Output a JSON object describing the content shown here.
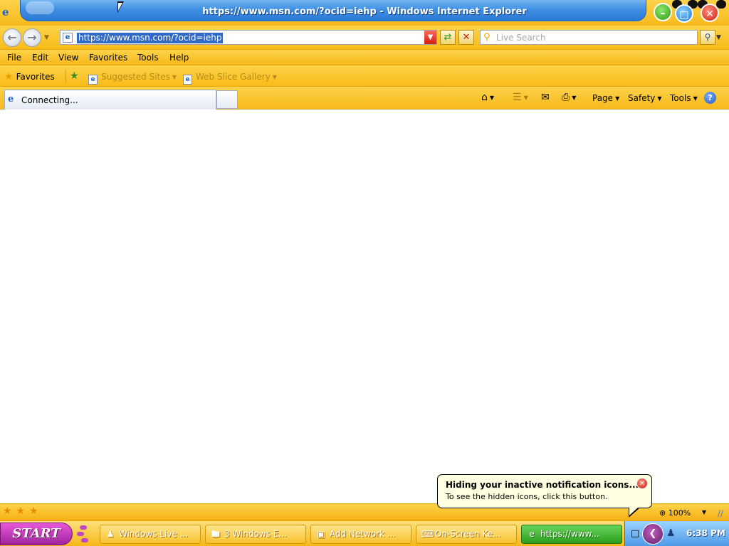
{
  "window": {
    "title": "https://www.msn.com/?ocid=iehp - Windows Internet Explorer",
    "buttons": {
      "minimize": "–",
      "maximize": "□",
      "close": "✕"
    }
  },
  "address": {
    "url": "https://www.msn.com/?ocid=iehp",
    "search_placeholder": "Live Search"
  },
  "menu": [
    "File",
    "Edit",
    "View",
    "Favorites",
    "Tools",
    "Help"
  ],
  "favorites_bar": {
    "favorites_label": "Favorites",
    "links": [
      "Suggested Sites",
      "Web Slice Gallery"
    ]
  },
  "tabs": [
    {
      "label": "Connecting..."
    }
  ],
  "command_bar": {
    "page_label": "Page",
    "safety_label": "Safety",
    "tools_label": "Tools",
    "help_label": "?"
  },
  "status_bar": {
    "zoom": "100%"
  },
  "notification": {
    "title": "Hiding your inactive notification icons...",
    "message": "To see the hidden icons, click this button."
  },
  "taskbar": {
    "start_label": "START",
    "tasks": [
      {
        "label": "Windows Live ...",
        "icon": "users-icon"
      },
      {
        "label": "3 Windows E...",
        "icon": "folder-icon"
      },
      {
        "label": "Add Network ...",
        "icon": "window-icon"
      },
      {
        "label": "On-Screen Ke...",
        "icon": "keyboard-icon"
      },
      {
        "label": "https://www...",
        "icon": "ie-icon",
        "active": true
      }
    ],
    "clock": "6:38 PM"
  },
  "colors": {
    "chrome": "#f9bb18",
    "titlebar_blue": "#3f8fe3",
    "start": "#b631b0",
    "active_task": "#2b9e1f",
    "balloon": "#ffffe1"
  }
}
